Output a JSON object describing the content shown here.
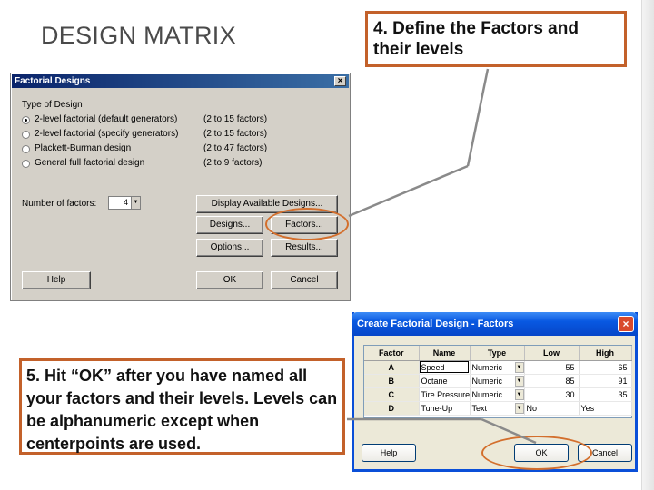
{
  "slide": {
    "title": "DESIGN MATRIX",
    "callout_top": "4.  Define the Factors and their levels",
    "callout_bottom": "5. Hit “OK” after you have named all your factors and their levels.  Levels can be alphanumeric except when centerpoints are used."
  },
  "factorial_dialog": {
    "title": "Factorial Designs",
    "close": "×",
    "type_label": "Type of Design",
    "options": [
      {
        "label": "2-level factorial (default generators)",
        "range": "(2 to 15 factors)",
        "selected": true
      },
      {
        "label": "2-level factorial (specify generators)",
        "range": "(2 to 15 factors)",
        "selected": false
      },
      {
        "label": "Plackett-Burman design",
        "range": "(2 to 47 factors)",
        "selected": false
      },
      {
        "label": "General full factorial design",
        "range": "(2 to 9 factors)",
        "selected": false
      }
    ],
    "num_factors_label": "Number of factors:",
    "num_factors_value": "4",
    "buttons": {
      "display": "Display Available Designs...",
      "designs": "Designs...",
      "factors": "Factors...",
      "options": "Options...",
      "results": "Results...",
      "help": "Help",
      "ok": "OK",
      "cancel": "Cancel"
    }
  },
  "factors_dialog": {
    "title": "Create Factorial Design - Factors",
    "close": "×",
    "columns": [
      "Factor",
      "Name",
      "Type",
      "Low",
      "High"
    ],
    "rows": [
      {
        "factor": "A",
        "name": "Speed",
        "type": "Numeric",
        "low": "55",
        "high": "65"
      },
      {
        "factor": "B",
        "name": "Octane",
        "type": "Numeric",
        "low": "85",
        "high": "91"
      },
      {
        "factor": "C",
        "name": "Tire Pressure",
        "type": "Numeric",
        "low": "30",
        "high": "35"
      },
      {
        "factor": "D",
        "name": "Tune-Up",
        "type": "Text",
        "low": "No",
        "high": "Yes"
      }
    ],
    "buttons": {
      "help": "Help",
      "ok": "OK",
      "cancel": "Cancel"
    }
  },
  "colors": {
    "accent": "#c3612a",
    "highlight": "#d36f2d",
    "classic_title": "#0a246a",
    "xp_title": "#0858e1"
  }
}
